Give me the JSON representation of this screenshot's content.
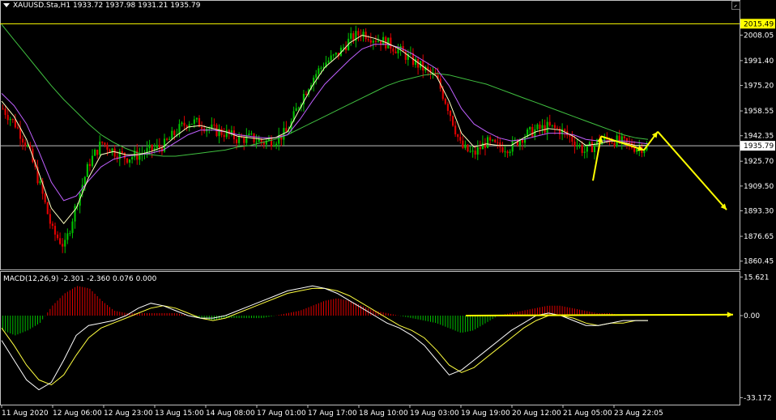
{
  "header": {
    "symbol_line": "XAUUSD.Sta,H1  1933.72 1937.98 1931.21 1935.79"
  },
  "macd_header": "MACD(12,26,9) -2.301 -2.360 0.076 0.000",
  "colors": {
    "background": "#000000",
    "frame": "#c0c0c0",
    "bull_candle": "#00c000",
    "bear_candle": "#e00000",
    "ma_fast": "#ffffc0",
    "ma_mid": "#c060ff",
    "ma_slow": "#40c040",
    "macd_line": "#ffffff",
    "signal_line": "#ffff40",
    "annotation": "#ffff00",
    "price_line": "#c0c0c0"
  },
  "chart_data": [
    {
      "type": "candlestick",
      "symbol": "XAUUSD.Sta",
      "timeframe": "H1",
      "ohlc_current": {
        "open": 1933.72,
        "high": 1937.98,
        "low": 1931.21,
        "close": 1935.79
      },
      "ylim": [
        1855.0,
        2022.0
      ],
      "y_ticks": [
        "2008.05",
        "1991.40",
        "1975.20",
        "1958.55",
        "1942.35",
        "1925.70",
        "1909.50",
        "1893.30",
        "1876.65",
        "1860.45"
      ],
      "y_tick_values": [
        2008.05,
        1991.4,
        1975.2,
        1958.55,
        1942.35,
        1925.7,
        1909.5,
        1893.3,
        1876.65,
        1860.45
      ],
      "highlighted_prices": [
        {
          "label": "2015.49",
          "value": 2015.49,
          "style": "yellow"
        },
        {
          "label": "1935.79",
          "value": 1935.79,
          "style": "white"
        }
      ],
      "x_ticks": [
        "11 Aug 2020",
        "12 Aug 06:00",
        "12 Aug 23:00",
        "13 Aug 15:00",
        "14 Aug 08:00",
        "17 Aug 01:00",
        "17 Aug 17:00",
        "18 Aug 10:00",
        "19 Aug 03:00",
        "19 Aug 19:00",
        "20 Aug 12:00",
        "21 Aug 05:00",
        "23 Aug 22:05"
      ],
      "close_profile": [
        1960,
        1950,
        1935,
        1910,
        1880,
        1870,
        1900,
        1925,
        1938,
        1932,
        1928,
        1930,
        1933,
        1936,
        1945,
        1952,
        1950,
        1946,
        1944,
        1940,
        1941,
        1938,
        1940,
        1945,
        1965,
        1980,
        1990,
        1995,
        2005,
        2010,
        2006,
        2003,
        1998,
        1992,
        1986,
        1980,
        1960,
        1935,
        1930,
        1938,
        1935,
        1935,
        1942,
        1946,
        1948,
        1946,
        1940,
        1932,
        1938,
        1940,
        1938,
        1935,
        1935
      ],
      "ma_fast": [
        1965,
        1955,
        1940,
        1918,
        1895,
        1885,
        1895,
        1915,
        1930,
        1932,
        1930,
        1930,
        1932,
        1935,
        1942,
        1948,
        1949,
        1947,
        1945,
        1942,
        1941,
        1940,
        1941,
        1945,
        1960,
        1975,
        1987,
        1994,
        2003,
        2008,
        2006,
        2003,
        1999,
        1993,
        1987,
        1981,
        1965,
        1944,
        1935,
        1937,
        1936,
        1936,
        1941,
        1945,
        1947,
        1946,
        1942,
        1936,
        1937,
        1939,
        1938,
        1936,
        1936
      ],
      "ma_mid": [
        1970,
        1962,
        1950,
        1932,
        1912,
        1900,
        1903,
        1913,
        1922,
        1927,
        1929,
        1930,
        1931,
        1933,
        1938,
        1943,
        1946,
        1946,
        1945,
        1943,
        1942,
        1941,
        1941,
        1943,
        1953,
        1965,
        1976,
        1984,
        1992,
        1999,
        2002,
        2002,
        2000,
        1996,
        1991,
        1986,
        1975,
        1960,
        1950,
        1945,
        1941,
        1939,
        1940,
        1942,
        1944,
        1944,
        1943,
        1940,
        1939,
        1939,
        1939,
        1938,
        1937
      ],
      "ma_slow": [
        2015,
        2005,
        1995,
        1985,
        1975,
        1966,
        1958,
        1950,
        1943,
        1938,
        1934,
        1931,
        1930,
        1929,
        1929,
        1930,
        1931,
        1932,
        1933,
        1935,
        1936,
        1938,
        1940,
        1943,
        1947,
        1951,
        1955,
        1959,
        1963,
        1967,
        1971,
        1975,
        1978,
        1980,
        1982,
        1983,
        1982,
        1980,
        1978,
        1976,
        1973,
        1970,
        1967,
        1964,
        1961,
        1958,
        1955,
        1952,
        1949,
        1946,
        1943,
        1941,
        1940
      ],
      "annotation": "yellow projection arrows: rise to about 1943 then decline toward about 1895"
    },
    {
      "type": "macd",
      "title": "MACD(12,26,9) -2.301 -2.360 0.076 0.000",
      "params": [
        12,
        26,
        9
      ],
      "values": {
        "macd": -2.301,
        "signal": -2.36,
        "histogram": 0.076,
        "zero": 0.0
      },
      "ylim": [
        -36,
        18
      ],
      "y_ticks": [
        "15.621",
        "0.00",
        "-33.172"
      ],
      "y_tick_values": [
        15.621,
        0.0,
        -33.172
      ],
      "histogram": [
        -6,
        -8,
        -6,
        -3,
        4,
        9,
        12,
        11,
        6,
        2,
        1,
        1,
        1,
        1,
        1,
        0,
        -1,
        -2,
        -1,
        -1,
        -1,
        -1,
        0,
        1,
        2,
        4,
        6,
        7,
        6,
        4,
        2,
        1,
        0,
        -1,
        -2,
        -3,
        -5,
        -7,
        -6,
        -3,
        0,
        1,
        2,
        3,
        4,
        4,
        3,
        2,
        1,
        1,
        0,
        0,
        0
      ],
      "macd_line": [
        -10,
        -18,
        -26,
        -30,
        -27,
        -18,
        -8,
        -4,
        -3,
        -2,
        0,
        3,
        5,
        4,
        2,
        0,
        -1,
        -1,
        0,
        2,
        4,
        6,
        8,
        10,
        11,
        12,
        11,
        9,
        6,
        3,
        0,
        -3,
        -5,
        -8,
        -12,
        -18,
        -24,
        -22,
        -18,
        -14,
        -10,
        -6,
        -3,
        0,
        1,
        0,
        -2,
        -4,
        -4,
        -3,
        -2,
        -2,
        -2
      ],
      "signal_line": [
        -5,
        -12,
        -20,
        -26,
        -28,
        -24,
        -16,
        -9,
        -5,
        -3,
        -1,
        1,
        3,
        4,
        3,
        1,
        -1,
        -2,
        -1,
        1,
        3,
        5,
        7,
        9,
        10,
        11,
        11,
        10,
        8,
        5,
        2,
        -1,
        -4,
        -6,
        -9,
        -14,
        -20,
        -23,
        -21,
        -17,
        -13,
        -9,
        -5,
        -2,
        0,
        0,
        -1,
        -3,
        -4,
        -3,
        -3,
        -2,
        -2
      ],
      "annotation": "yellow horizontal arrow along zero line"
    }
  ]
}
